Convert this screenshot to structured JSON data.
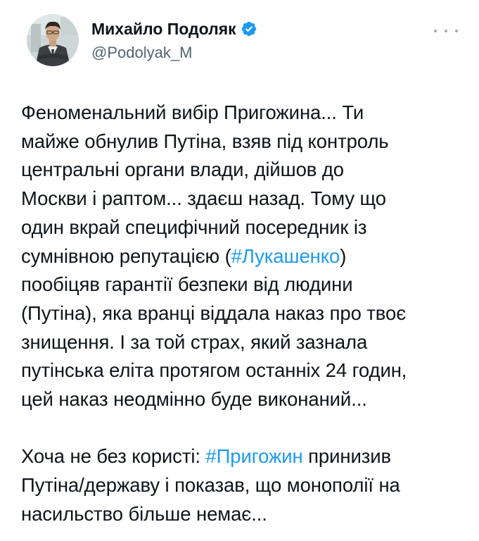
{
  "author": {
    "display_name": "Михайло Подоляк",
    "handle": "@Podolyak_M",
    "verified": true,
    "verified_icon": "verified-badge-icon",
    "verified_color": "#1d9bf0"
  },
  "menu": {
    "icon": "more-options-icon"
  },
  "tweet": {
    "paragraph1": {
      "l1": "Феноменальний вибір Пригожина... Ти",
      "l2": "майже обнулив Путіна, взяв під контроль",
      "l3": "центральні органи влади, дійшов до",
      "l4": "Москви і раптом... здаєш назад. Тому що",
      "l5": "один вкрай специфічний посередник із",
      "l6_before": "сумнівною репутацією (",
      "l6_tag": "#Лукашенко",
      "l6_after": ")",
      "l7": "пообіцяв гарантії безпеки від людини",
      "l8": "(Путіна), яка вранці віддала наказ про твоє",
      "l9": "знищення. І за той страх, який зазнала",
      "l10": "путінська еліта протягом останніх 24 годин,",
      "l11": "цей наказ неодмінно буде виконаний..."
    },
    "paragraph2": {
      "l1_before": "Хоча не без користі: ",
      "l1_tag": "#Пригожин",
      "l1_after": " принизив",
      "l2": "Путіна/державу і показав, що монополії на",
      "l3": "насильство більше немає..."
    }
  },
  "colors": {
    "text": "#0f1419",
    "secondary": "#536471",
    "link": "#1d9bf0"
  }
}
